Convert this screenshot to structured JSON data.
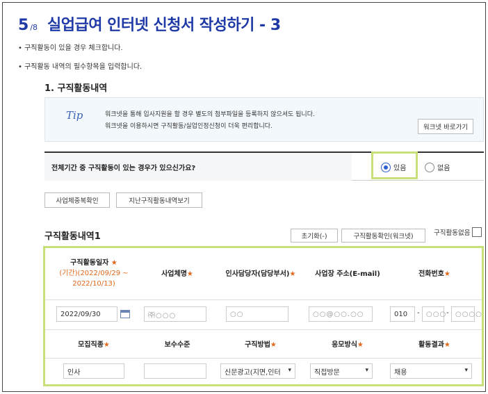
{
  "header": {
    "step_num": "5",
    "step_total": "/8",
    "title": "실업급여 인터넷 신청서 작성하기 - 3"
  },
  "notes": [
    "• 구직활동이 있을 경우 체크합니다.",
    "• 구직활동 내역의 필수항목을 입력합니다."
  ],
  "section": {
    "title": "1. 구직활동내역",
    "tip": {
      "label": "Tip",
      "lines": [
        "워크넷을 통해 입사지원을 할 경우 별도의 첨부파일을 등록하지 않으셔도 됩니다.",
        "워크넷을 이용하시면 구직활동/실업인정신청이 더욱 편리합니다."
      ],
      "button": "워크넷 바로가기"
    }
  },
  "question": {
    "label": "전체기간 중 구직활동이 있는 경우가 있으신가요?",
    "opt_yes": "있음",
    "opt_no": "없음",
    "selected": "있음"
  },
  "buttons": {
    "dup_check": "사업체중복확인",
    "past_view": "지난구직활동내역보기"
  },
  "activity": {
    "title": "구직활동내역1",
    "reset": "초기화(-)",
    "confirm": "구직활동확인(워크넷)",
    "none_label": "구직활동없음",
    "headers1": {
      "date": "구직활동일자",
      "date_range": "(기간)(2022/09/29 ~ 2022/10/13)",
      "company": "사업체명",
      "manager": "인사담당자(담당부서)",
      "address": "사업장 주소(E-mail)",
      "phone": "전화번호"
    },
    "values1": {
      "date": "2022/09/30",
      "company": "㈜○○○",
      "manager": "○○",
      "address": "○○@○○.○○",
      "phone1": "010",
      "phone2": "○○○",
      "phone3": "○○○○"
    },
    "headers2": {
      "job": "모집직종",
      "salary": "보수수준",
      "method": "구직방법",
      "apply": "응모방식",
      "result": "활동결과"
    },
    "values2": {
      "job": "인사",
      "salary": "",
      "method": "신문광고(지면,인터",
      "apply": "직접방문",
      "result": "채용"
    }
  },
  "colors": {
    "title_blue": "#1f3aa6",
    "highlight": "#c7e07a",
    "required_star": "#e1671a"
  }
}
